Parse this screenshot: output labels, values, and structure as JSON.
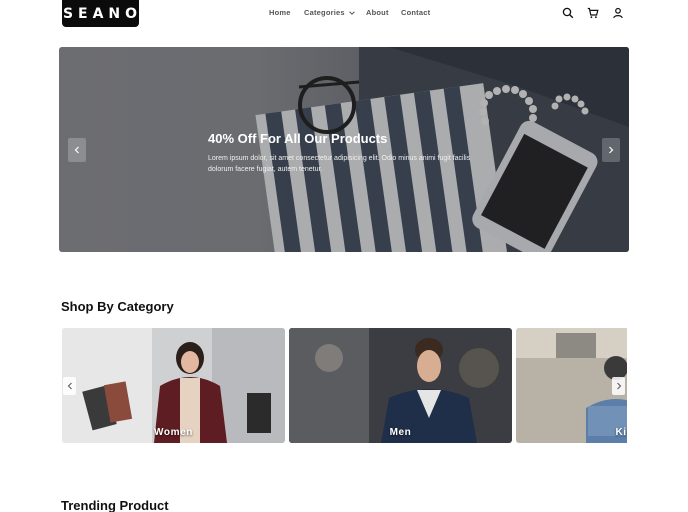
{
  "brand": {
    "logo_text": "SEANO"
  },
  "nav": {
    "items": [
      {
        "label": "Home"
      },
      {
        "label": "Categories"
      },
      {
        "label": "About"
      },
      {
        "label": "Contact"
      }
    ]
  },
  "header_icons": [
    "search-icon",
    "cart-icon",
    "user-icon"
  ],
  "hero": {
    "title": "40% Off For All Our Products",
    "text": "Lorem ipsum dolor, sit amet consectetur adipisicing elit. Odio minus animi fugit facilis dolorum facere fugiat, autem tenetur."
  },
  "categories": {
    "title": "Shop By Category",
    "items": [
      {
        "label": "Women"
      },
      {
        "label": "Men"
      },
      {
        "label": "Kids"
      }
    ]
  },
  "trending": {
    "title": "Trending Product"
  },
  "colors": {
    "logo_bg": "#0b0b0b",
    "text": "#111111",
    "nav_text": "#555555"
  }
}
